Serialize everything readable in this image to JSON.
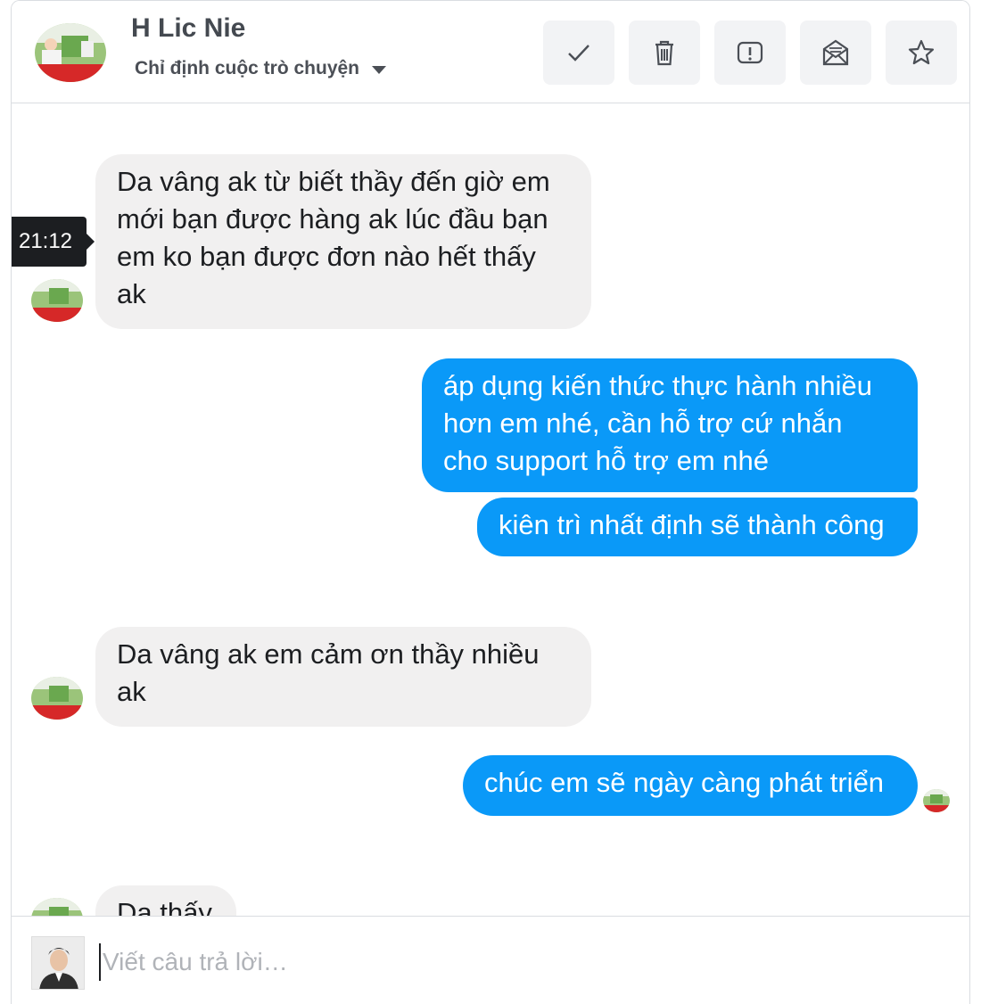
{
  "header": {
    "contact_name": "H Lic Nie",
    "assign_label": "Chỉ định cuộc trò chuyện",
    "actions": [
      {
        "name": "mark-done",
        "icon": "check-icon"
      },
      {
        "name": "delete",
        "icon": "trash-icon"
      },
      {
        "name": "report",
        "icon": "exclamation-icon"
      },
      {
        "name": "mark-unread",
        "icon": "envelope-icon"
      },
      {
        "name": "star",
        "icon": "star-icon"
      }
    ]
  },
  "thread": {
    "tooltip_time": "21:12",
    "messages": [
      {
        "dir": "in",
        "lines": [
          "Da vâng ak từ biết thầy đến giờ em",
          "mới bạn được hàng ak lúc đầu bạn",
          "em ko bạn được đơn nào hết thấy",
          "ak"
        ]
      },
      {
        "dir": "out",
        "lines": [
          "áp dụng kiến thức thực hành nhiều",
          "hơn em nhé, cần hỗ trợ cứ nhắn",
          "cho support hỗ trợ em nhé"
        ]
      },
      {
        "dir": "out",
        "lines": [
          "kiên trì nhất định sẽ thành công"
        ]
      },
      {
        "dir": "in",
        "lines": [
          "Da vâng ak em cảm ơn thầy nhiều",
          "ak"
        ]
      },
      {
        "dir": "out",
        "lines": [
          "chúc em sẽ ngày càng phát triển"
        ]
      },
      {
        "dir": "in",
        "lines": [
          "Da thấy"
        ]
      }
    ]
  },
  "composer": {
    "placeholder": "Viết câu trả lời…"
  },
  "colors": {
    "outgoing_bubble": "#0a99f8",
    "incoming_bubble": "#f1f0f0",
    "tool_button_bg": "#f2f3f5"
  }
}
